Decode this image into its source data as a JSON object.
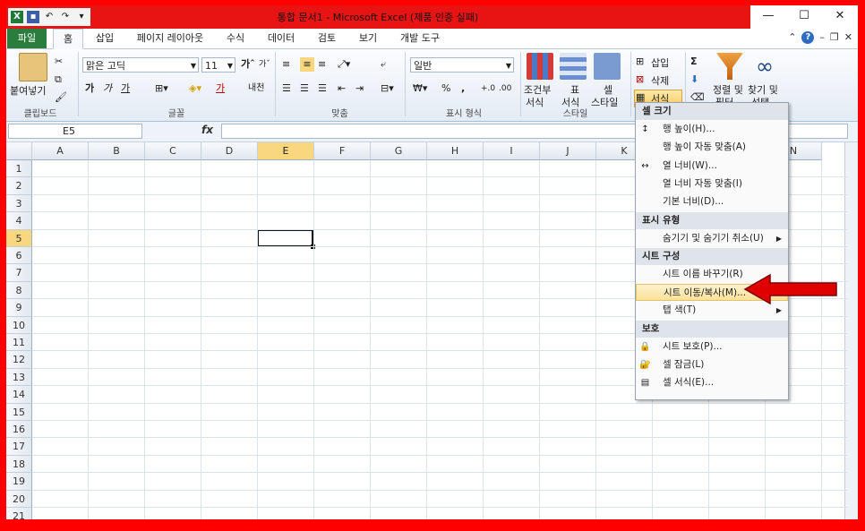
{
  "window": {
    "title": "통합 문서1  -  Microsoft Excel (제품 인증 실패)",
    "qat_items": [
      "excel-logo-icon",
      "save-icon",
      "undo-icon",
      "redo-icon",
      "customize-icon"
    ],
    "controls": {
      "minimize": "—",
      "maximize": "☐",
      "close": "✕"
    }
  },
  "tabs": [
    "파일",
    "홈",
    "삽입",
    "페이지 레이아웃",
    "수식",
    "데이터",
    "검토",
    "보기",
    "개발 도구"
  ],
  "active_tab": "홈",
  "ribbon": {
    "clipboard": {
      "paste": "붙여넣기",
      "label": "클립보드"
    },
    "font": {
      "name": "맑은 고딕",
      "size": "11",
      "bold": "가",
      "italic": "가",
      "underline": "가",
      "fontcolor": "가",
      "phonetic": "내천",
      "label": "글꼴"
    },
    "align": {
      "label": "맞춤"
    },
    "number": {
      "format": "일반",
      "percent": "%",
      "comma": ",",
      "label": "표시 형식"
    },
    "style": {
      "cond": "조건부",
      "cond2": "서식",
      "table": "표",
      "table2": "서식",
      "cell": "셀",
      "cell2": "스타일",
      "label": "스타일"
    },
    "cells": {
      "insert": "삽입",
      "delete": "삭제",
      "format": "서식"
    },
    "editing": {
      "sort": "정렬 및",
      "sort2": "필터",
      "find": "찾기 및",
      "find2": "선택",
      "sigma": "Σ"
    }
  },
  "formula_bar": {
    "name_box": "E5",
    "fx": "fx",
    "value": ""
  },
  "grid": {
    "columns": [
      "A",
      "B",
      "C",
      "D",
      "E",
      "F",
      "G",
      "H",
      "I",
      "J",
      "K",
      "L",
      "M",
      "N"
    ],
    "rows": [
      "1",
      "2",
      "3",
      "4",
      "5",
      "6",
      "7",
      "8",
      "9",
      "10",
      "11",
      "12",
      "13",
      "14",
      "15",
      "16",
      "17",
      "18",
      "19",
      "20",
      "21"
    ],
    "active_col": "E",
    "active_row": "5"
  },
  "menu": {
    "sections": [
      {
        "header": "셀 크기",
        "items": [
          {
            "label": "행 높이(H)...",
            "icon": "row-height-icon"
          },
          {
            "label": "행 높이 자동 맞춤(A)",
            "icon": ""
          },
          {
            "label": "열 너비(W)...",
            "icon": "column-width-icon"
          },
          {
            "label": "열 너비 자동 맞춤(I)",
            "icon": ""
          },
          {
            "label": "기본 너비(D)...",
            "icon": ""
          }
        ]
      },
      {
        "header": "표시 유형",
        "items": [
          {
            "label": "숨기기 및 숨기기 취소(U)",
            "icon": "",
            "submenu": true
          }
        ]
      },
      {
        "header": "시트 구성",
        "items": [
          {
            "label": "시트 이름 바꾸기(R)",
            "icon": ""
          },
          {
            "label": "시트 이동/복사(M)...",
            "icon": "",
            "highlighted": true
          },
          {
            "label": "탭 색(T)",
            "icon": "",
            "submenu": true
          }
        ]
      },
      {
        "header": "보호",
        "items": [
          {
            "label": "시트 보호(P)...",
            "icon": "protect-sheet-icon"
          },
          {
            "label": "셀 잠금(L)",
            "icon": "lock-cell-icon"
          },
          {
            "label": "셀 서식(E)...",
            "icon": "format-cells-icon"
          }
        ]
      }
    ]
  },
  "colors": {
    "frame": "#ff0000",
    "file_tab": "#2a7d3c",
    "highlight": "#fbe29a",
    "selected_header": "#f8d77e",
    "arrow": "#e00000"
  }
}
